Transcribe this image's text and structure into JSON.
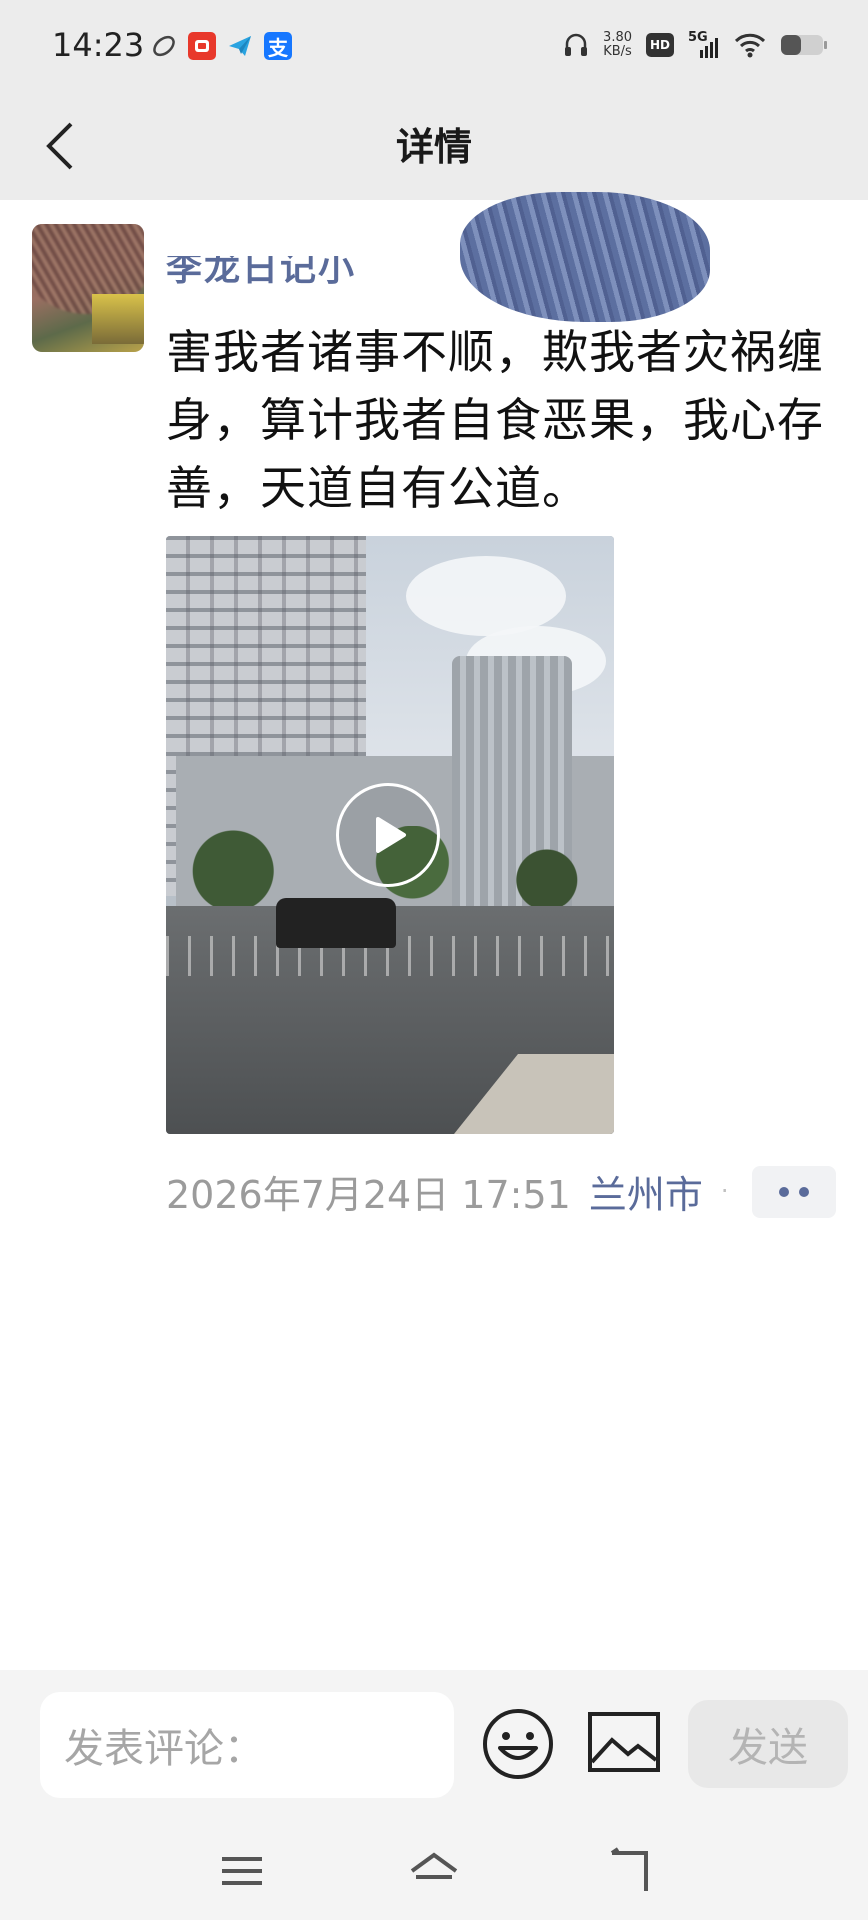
{
  "status_bar": {
    "time": "14:23",
    "net_speed_value": "3.80",
    "net_speed_unit": "KB/s",
    "hd_label": "HD",
    "network_type": "5G",
    "app_icons": [
      "leaf-icon",
      "pinduoduo-icon",
      "paper-plane-icon",
      "alipay-icon"
    ],
    "alipay_glyph": "支"
  },
  "nav": {
    "title": "详情"
  },
  "post": {
    "nickname_partial": "李龙日记小",
    "text": "害我者诸事不顺，欺我者灾祸缠身，算计我者自食恶果，我心存善，天道自有公道。",
    "media_type": "video",
    "timestamp": "2026年7月24日 17:51",
    "location": "兰州市",
    "separator": "·"
  },
  "comment_bar": {
    "placeholder": "发表评论：",
    "send_label": "发送"
  },
  "colors": {
    "bar_background": "#ececec",
    "link_blue": "#5a6b9a",
    "meta_gray": "#9b9b9b",
    "send_disabled": "#e8e8e8"
  }
}
